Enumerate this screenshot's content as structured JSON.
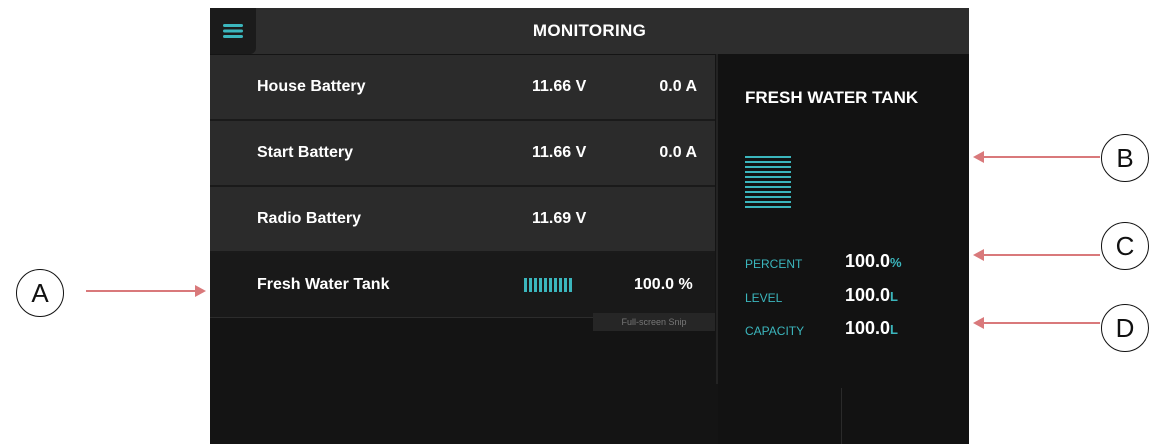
{
  "header": {
    "title": "MONITORING",
    "menu_icon": "hamburger-icon"
  },
  "list": [
    {
      "name": "House Battery",
      "voltage": "11.66 V",
      "current": "0.0 A"
    },
    {
      "name": "Start Battery",
      "voltage": "11.66 V",
      "current": "0.0 A"
    },
    {
      "name": "Radio Battery",
      "voltage": "11.69 V"
    },
    {
      "name": "Fresh Water Tank",
      "percent": "100.0 %",
      "level_fraction": 1.0,
      "selected": true
    }
  ],
  "tooltip": "Full-screen Snip",
  "detail": {
    "title": "FRESH WATER TANK",
    "tank_level_fraction": 1.0,
    "percent_label": "PERCENT",
    "percent_value": "100.0",
    "percent_unit": "%",
    "level_label": "LEVEL",
    "level_value": "100.0",
    "level_unit": "L",
    "capacity_label": "CAPACITY",
    "capacity_value": "100.0",
    "capacity_unit": "L"
  },
  "callouts": {
    "a": "A",
    "b": "B",
    "c": "C",
    "d": "D"
  },
  "colors": {
    "accent": "#3bb6bd",
    "arrow": "#d9797b",
    "background": "#141414",
    "row": "#2b2b2b"
  }
}
